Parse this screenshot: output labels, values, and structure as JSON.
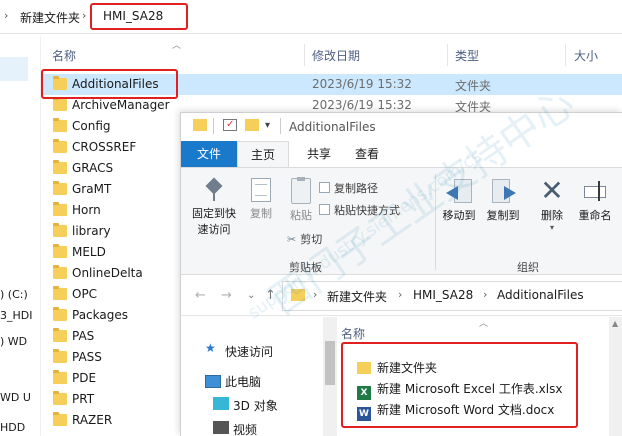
{
  "back_window": {
    "breadcrumb": [
      "新建文件夹",
      "HMI_SA28"
    ],
    "columns": {
      "name": "名称",
      "date": "修改日期",
      "type": "类型",
      "size": "大小"
    },
    "files": [
      {
        "name": "AdditionalFiles",
        "date": "2023/6/19 15:32",
        "type": "文件夹"
      },
      {
        "name": "ArchiveManager",
        "date": "2023/6/19 15:32",
        "type": "文件夹"
      },
      {
        "name": "Config",
        "date": "",
        "type": ""
      },
      {
        "name": "CROSSREF",
        "date": "",
        "type": ""
      },
      {
        "name": "GRACS",
        "date": "",
        "type": ""
      },
      {
        "name": "GraMT",
        "date": "",
        "type": ""
      },
      {
        "name": "Horn",
        "date": "",
        "type": ""
      },
      {
        "name": "library",
        "date": "",
        "type": ""
      },
      {
        "name": "MELD",
        "date": "",
        "type": ""
      },
      {
        "name": "OnlineDelta",
        "date": "",
        "type": ""
      },
      {
        "name": "OPC",
        "date": "",
        "type": ""
      },
      {
        "name": "Packages",
        "date": "",
        "type": ""
      },
      {
        "name": "PAS",
        "date": "",
        "type": ""
      },
      {
        "name": "PASS",
        "date": "",
        "type": ""
      },
      {
        "name": "PDE",
        "date": "",
        "type": ""
      },
      {
        "name": "PRT",
        "date": "",
        "type": ""
      },
      {
        "name": "RAZER",
        "date": "",
        "type": ""
      }
    ],
    "nav_drives": [
      ") (C:)",
      "3_HDI",
      ") WD",
      "WD U",
      "HDD"
    ]
  },
  "front_window": {
    "title": "AdditionalFiles",
    "tabs": {
      "file": "文件",
      "home": "主页",
      "share": "共享",
      "view": "查看"
    },
    "ribbon": {
      "pin_line1": "固定到快",
      "pin_line2": "速访问",
      "copy": "复制",
      "paste": "粘贴",
      "copy_path": "复制路径",
      "paste_shortcut": "粘贴快捷方式",
      "cut": "剪切",
      "clipboard_group": "剪贴板",
      "move_to": "移动到",
      "copy_to": "复制到",
      "delete": "删除",
      "rename": "重命名",
      "organize_group": "组织"
    },
    "breadcrumb": [
      "新建文件夹",
      "HMI_SA28",
      "AdditionalFiles"
    ],
    "nav": {
      "quick_access": "快速访问",
      "this_pc": "此电脑",
      "objects3d": "3D 对象",
      "videos": "视频"
    },
    "list_header": "名称",
    "new_items": [
      {
        "name": "新建文件夹",
        "icon": "folder-icon"
      },
      {
        "name": "新建 Microsoft Excel 工作表.xlsx",
        "icon": "excel-icon"
      },
      {
        "name": "新建 Microsoft Word 文档.docx",
        "icon": "word-icon"
      }
    ]
  },
  "watermark": {
    "main": "西门子工业支持中心",
    "url": "support.industry.siemens.com/cs"
  }
}
